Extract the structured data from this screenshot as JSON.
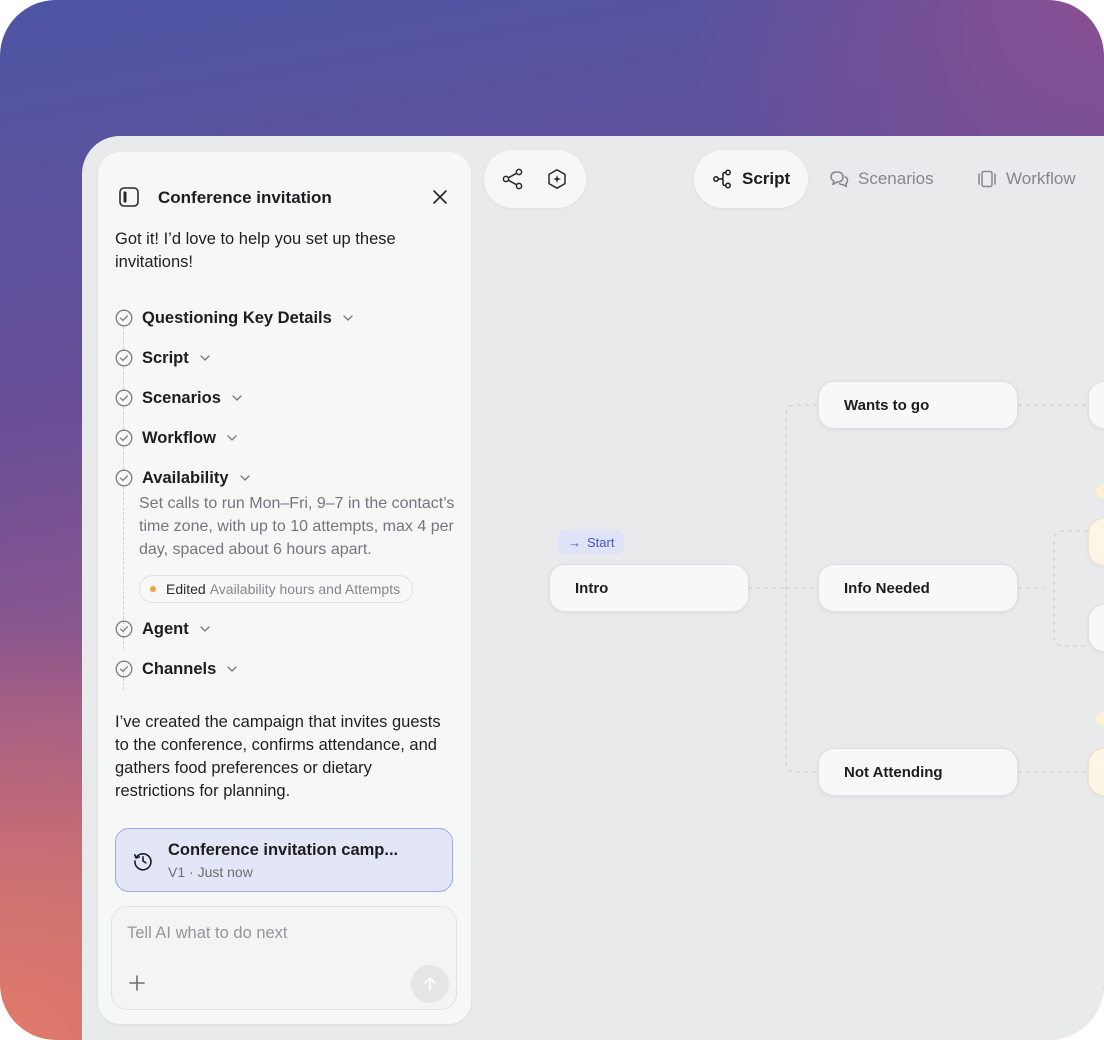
{
  "chat": {
    "title": "Conference invitation",
    "intro": "Got it! I’d love to help you set up these invitations!",
    "steps": [
      {
        "label": "Questioning Key Details"
      },
      {
        "label": "Script"
      },
      {
        "label": "Scenarios"
      },
      {
        "label": "Workflow"
      },
      {
        "label": "Availability"
      },
      {
        "label": "Agent"
      },
      {
        "label": "Channels"
      }
    ],
    "availability_detail": "Set calls to run Mon–Fri, 9–7 in the contact’s time zone, with up to 10 attempts, max 4 per day, spaced about 6 hours apart.",
    "edited": {
      "strong": "Edited",
      "text": "Availability hours and Attempts",
      "dot_color": "#f1a23a"
    },
    "outro": "I’ve created the campaign that invites guests to the conference, confirms attendance, and gathers food preferences or dietary restrictions for planning.",
    "version_card": {
      "title": "Conference invitation camp...",
      "subtitle": "V1 · Just now"
    },
    "composer": {
      "placeholder": "Tell AI what to do next"
    }
  },
  "toolbar": {
    "icons": [
      "share-nodes-icon",
      "sparkle-hexagon-icon"
    ]
  },
  "tabs": [
    {
      "label": "Script",
      "icon": "script-nodes-icon",
      "active": true
    },
    {
      "label": "Scenarios",
      "icon": "chat-bubbles-icon",
      "active": false
    },
    {
      "label": "Workflow",
      "icon": "workflow-cards-icon",
      "active": false
    }
  ],
  "flow": {
    "start_label": "Start",
    "nodes": {
      "intro": "Intro",
      "wants_to_go": "Wants to go",
      "info_needed": "Info Needed",
      "not_attending": "Not Attending"
    }
  },
  "colors": {
    "accent": "#4a57c2",
    "version_card_bg": "#e3e6f7",
    "version_card_border": "#9fa9e6",
    "canvas_bg": "#e9eaec",
    "edited_dot": "#f1a23a"
  }
}
